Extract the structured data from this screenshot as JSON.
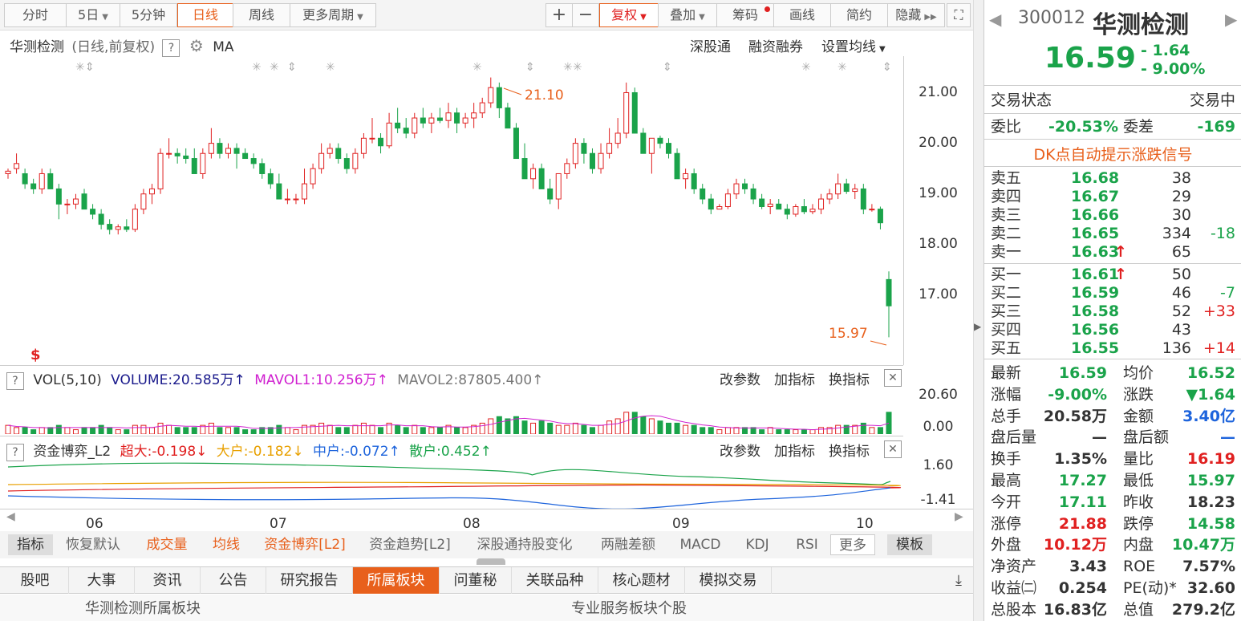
{
  "toolbar": {
    "buttons": [
      "分时",
      "5日",
      "5分钟",
      "日线",
      "周线",
      "更多周期"
    ],
    "plus": "+",
    "minus": "−",
    "fuquan": "复权",
    "diejia": "叠加",
    "chouma": "筹码",
    "huaxian": "画线",
    "jianyue": "简约",
    "yincang": "隐藏"
  },
  "chart_header": {
    "name": "华测检测",
    "mode": "(日线,前复权)",
    "q": "?",
    "ma": "MA"
  },
  "chart_links": {
    "sgt": "深股通",
    "rzrq": "融资融券",
    "ma_setting": "设置均线"
  },
  "price_axis": [
    "21.00",
    "20.00",
    "19.00",
    "18.00",
    "17.00"
  ],
  "annotations": {
    "high": "21.10",
    "low": "15.97",
    "s_mark": "$"
  },
  "vol_panel": {
    "label": "VOL(5,10)",
    "volume": "VOLUME:20.585万",
    "mavol1": "MAVOL1:10.256万",
    "mavol2": "MAVOL2:87805.400",
    "axis_top": "20.60",
    "axis_bottom": "0.00"
  },
  "fund_panel": {
    "label": "资金博弈_L2",
    "super": "超大:-0.198",
    "large": "大户:-0.182",
    "mid": "中户:-0.072",
    "retail": "散户:0.452",
    "axis_top": "1.60",
    "axis_bottom": "-1.41"
  },
  "panel_links": {
    "gai": "改参数",
    "jia": "加指标",
    "huan": "换指标"
  },
  "months": [
    "06",
    "07",
    "08",
    "09",
    "10"
  ],
  "indicator_tabs": [
    "指标",
    "恢复默认",
    "成交量",
    "均线",
    "资金博弈[L2]",
    "资金趋势[L2]",
    "深股通持股变化",
    "两融差额",
    "MACD",
    "KDJ",
    "RSI",
    "更多",
    "模板"
  ],
  "bottom_tabs": [
    "股吧",
    "大事",
    "资讯",
    "公告",
    "研究报告",
    "所属板块",
    "问董秘",
    "关联品种",
    "核心题材",
    "模拟交易"
  ],
  "sector_bar": {
    "left": "华测检测所属板块",
    "right": "专业服务板块个股"
  },
  "stock": {
    "code": "300012",
    "name": "华测检测",
    "price": "16.59",
    "change": "- 1.64",
    "pct": "- 9.00%"
  },
  "status": {
    "label": "交易状态",
    "value": "交易中"
  },
  "weibi": {
    "label": "委比",
    "value": "-20.53%",
    "wc_label": "委差",
    "wc_value": "-169"
  },
  "dk_signal": "DK点自动提示涨跌信号",
  "asks": [
    {
      "label": "卖五",
      "price": "16.68",
      "vol": "38",
      "chg": ""
    },
    {
      "label": "卖四",
      "price": "16.67",
      "vol": "29",
      "chg": ""
    },
    {
      "label": "卖三",
      "price": "16.66",
      "vol": "30",
      "chg": ""
    },
    {
      "label": "卖二",
      "price": "16.65",
      "vol": "334",
      "chg": "-18"
    },
    {
      "label": "卖一",
      "price": "16.63",
      "vol": "65",
      "chg": "",
      "arrow": "↑"
    }
  ],
  "bids": [
    {
      "label": "买一",
      "price": "16.61",
      "vol": "50",
      "chg": "",
      "arrow": "↑"
    },
    {
      "label": "买二",
      "price": "16.59",
      "vol": "46",
      "chg": "-7"
    },
    {
      "label": "买三",
      "price": "16.58",
      "vol": "52",
      "chg": "+33"
    },
    {
      "label": "买四",
      "price": "16.56",
      "vol": "43",
      "chg": ""
    },
    {
      "label": "买五",
      "price": "16.55",
      "vol": "136",
      "chg": "+14"
    }
  ],
  "stats": [
    {
      "l1": "最新",
      "v1": "16.59",
      "c1": "green",
      "l2": "均价",
      "v2": "16.52",
      "c2": "green"
    },
    {
      "l1": "涨幅",
      "v1": "-9.00%",
      "c1": "green",
      "l2": "涨跌",
      "v2": "▼1.64",
      "c2": "green"
    },
    {
      "l1": "总手",
      "v1": "20.58万",
      "c1": "black",
      "l2": "金额",
      "v2": "3.40亿",
      "c2": "blue"
    },
    {
      "l1": "盘后量",
      "v1": "—",
      "c1": "black",
      "l2": "盘后额",
      "v2": "—",
      "c2": "blue"
    },
    {
      "l1": "换手",
      "v1": "1.35%",
      "c1": "black",
      "l2": "量比",
      "v2": "16.19",
      "c2": "red"
    },
    {
      "l1": "最高",
      "v1": "17.27",
      "c1": "green",
      "l2": "最低",
      "v2": "15.97",
      "c2": "green"
    },
    {
      "l1": "今开",
      "v1": "17.11",
      "c1": "green",
      "l2": "昨收",
      "v2": "18.23",
      "c2": "black"
    },
    {
      "l1": "涨停",
      "v1": "21.88",
      "c1": "red",
      "l2": "跌停",
      "v2": "14.58",
      "c2": "green"
    },
    {
      "l1": "外盘",
      "v1": "10.12万",
      "c1": "red",
      "l2": "内盘",
      "v2": "10.47万",
      "c2": "green"
    },
    {
      "l1": "净资产",
      "v1": "3.43",
      "c1": "black",
      "l2": "ROE",
      "v2": "7.57%",
      "c2": "black"
    },
    {
      "l1": "收益㈡",
      "v1": "0.254",
      "c1": "black",
      "l2": "PE(动)*",
      "v2": "32.60",
      "c2": "black"
    },
    {
      "l1": "总股本",
      "v1": "16.83亿",
      "c1": "black",
      "l2": "总值",
      "v2": "279.2亿",
      "c2": "black"
    }
  ],
  "colors": {
    "up": "#e02020",
    "down": "#1aa34a",
    "accent": "#e8601c",
    "blue": "#1e64dc"
  },
  "chart_data": {
    "type": "candlestick",
    "price_ylim": [
      15.5,
      21.6
    ],
    "candles": [
      [
        19.2,
        19.3,
        19.1,
        19.25
      ],
      [
        19.3,
        19.6,
        19.2,
        19.4
      ],
      [
        19.2,
        19.3,
        18.9,
        19.0
      ],
      [
        19.0,
        19.1,
        18.8,
        18.9
      ],
      [
        18.9,
        19.3,
        18.8,
        19.2
      ],
      [
        19.2,
        19.3,
        18.9,
        18.9
      ],
      [
        18.9,
        19.0,
        18.3,
        18.6
      ],
      [
        18.6,
        18.7,
        18.4,
        18.6
      ],
      [
        18.6,
        18.8,
        18.5,
        18.7
      ],
      [
        18.8,
        18.9,
        18.5,
        18.5
      ],
      [
        18.5,
        18.6,
        18.3,
        18.4
      ],
      [
        18.4,
        18.5,
        18.1,
        18.2
      ],
      [
        18.2,
        18.3,
        18.0,
        18.1
      ],
      [
        18.1,
        18.2,
        18.0,
        18.15
      ],
      [
        18.15,
        18.3,
        18.05,
        18.1
      ],
      [
        18.1,
        18.6,
        18.05,
        18.5
      ],
      [
        18.5,
        18.9,
        18.4,
        18.8
      ],
      [
        18.8,
        19.0,
        18.6,
        18.9
      ],
      [
        18.9,
        19.7,
        18.8,
        19.6
      ],
      [
        19.6,
        19.9,
        19.5,
        19.6
      ],
      [
        19.6,
        19.7,
        19.4,
        19.55
      ],
      [
        19.55,
        19.7,
        19.4,
        19.5
      ],
      [
        19.5,
        19.7,
        19.2,
        19.2
      ],
      [
        19.2,
        19.7,
        19.1,
        19.6
      ],
      [
        19.6,
        20.1,
        19.5,
        19.8
      ],
      [
        19.8,
        19.9,
        19.5,
        19.6
      ],
      [
        19.6,
        19.8,
        19.5,
        19.7
      ],
      [
        19.7,
        19.8,
        19.3,
        19.6
      ],
      [
        19.6,
        19.7,
        19.5,
        19.5
      ],
      [
        19.5,
        19.6,
        19.3,
        19.4
      ],
      [
        19.4,
        19.5,
        19.1,
        19.2
      ],
      [
        19.2,
        19.3,
        18.9,
        19.0
      ],
      [
        19.0,
        19.2,
        18.7,
        18.7
      ],
      [
        18.7,
        18.9,
        18.6,
        18.7
      ],
      [
        18.7,
        18.8,
        18.6,
        18.7
      ],
      [
        18.7,
        19.3,
        18.6,
        19.0
      ],
      [
        19.0,
        19.4,
        18.9,
        19.3
      ],
      [
        19.3,
        19.8,
        19.2,
        19.6
      ],
      [
        19.6,
        19.8,
        19.5,
        19.7
      ],
      [
        19.7,
        19.8,
        19.4,
        19.5
      ],
      [
        19.5,
        19.6,
        19.2,
        19.3
      ],
      [
        19.3,
        19.7,
        19.2,
        19.6
      ],
      [
        19.6,
        20.0,
        19.5,
        19.9
      ],
      [
        19.9,
        20.3,
        19.8,
        19.9
      ],
      [
        19.9,
        20.0,
        19.6,
        19.75
      ],
      [
        19.75,
        20.4,
        19.7,
        20.2
      ],
      [
        20.2,
        20.5,
        20.0,
        20.1
      ],
      [
        20.1,
        20.3,
        19.9,
        20.0
      ],
      [
        20.0,
        20.4,
        19.9,
        20.3
      ],
      [
        20.3,
        20.5,
        20.1,
        20.2
      ],
      [
        20.2,
        20.4,
        20.0,
        20.3
      ],
      [
        20.3,
        20.5,
        20.2,
        20.25
      ],
      [
        20.25,
        20.6,
        20.1,
        20.4
      ],
      [
        20.4,
        20.5,
        20.0,
        20.2
      ],
      [
        20.2,
        20.4,
        20.1,
        20.3
      ],
      [
        20.3,
        20.6,
        20.1,
        20.4
      ],
      [
        20.4,
        20.7,
        20.3,
        20.6
      ],
      [
        20.6,
        21.1,
        20.5,
        20.9
      ],
      [
        20.9,
        21.0,
        20.3,
        20.5
      ],
      [
        20.5,
        20.6,
        20.1,
        20.1
      ],
      [
        20.1,
        20.2,
        19.5,
        19.5
      ],
      [
        19.5,
        19.8,
        19.1,
        19.1
      ],
      [
        19.1,
        19.4,
        18.9,
        19.3
      ],
      [
        19.3,
        19.4,
        18.9,
        18.9
      ],
      [
        18.9,
        19.1,
        18.6,
        18.7
      ],
      [
        18.7,
        19.2,
        18.5,
        19.2
      ],
      [
        19.2,
        19.5,
        19.1,
        19.4
      ],
      [
        19.4,
        19.9,
        19.3,
        19.8
      ],
      [
        19.8,
        19.9,
        19.4,
        19.6
      ],
      [
        19.6,
        19.7,
        19.2,
        19.3
      ],
      [
        19.3,
        19.8,
        19.2,
        19.6
      ],
      [
        19.6,
        20.1,
        19.5,
        19.8
      ],
      [
        19.8,
        20.3,
        19.7,
        20.0
      ],
      [
        20.0,
        21.0,
        19.9,
        20.8
      ],
      [
        20.8,
        20.9,
        20.0,
        20.0
      ],
      [
        20.0,
        20.1,
        19.6,
        19.6
      ],
      [
        19.6,
        19.9,
        19.2,
        19.9
      ],
      [
        19.9,
        19.95,
        19.7,
        19.8
      ],
      [
        19.8,
        19.9,
        19.5,
        19.6
      ],
      [
        19.6,
        19.7,
        19.1,
        19.1
      ],
      [
        19.1,
        19.3,
        18.9,
        19.2
      ],
      [
        19.2,
        19.3,
        18.8,
        18.9
      ],
      [
        18.9,
        19.0,
        18.6,
        18.7
      ],
      [
        18.7,
        18.8,
        18.4,
        18.5
      ],
      [
        18.5,
        18.6,
        18.5,
        18.55
      ],
      [
        18.55,
        18.9,
        18.5,
        18.8
      ],
      [
        18.8,
        19.1,
        18.7,
        19.0
      ],
      [
        19.0,
        19.1,
        18.8,
        18.9
      ],
      [
        18.9,
        19.0,
        18.6,
        18.7
      ],
      [
        18.7,
        18.8,
        18.5,
        18.55
      ],
      [
        18.55,
        18.7,
        18.4,
        18.6
      ],
      [
        18.6,
        18.7,
        18.5,
        18.5
      ],
      [
        18.5,
        18.6,
        18.3,
        18.4
      ],
      [
        18.4,
        18.6,
        18.35,
        18.55
      ],
      [
        18.55,
        18.7,
        18.4,
        18.45
      ],
      [
        18.45,
        18.6,
        18.4,
        18.5
      ],
      [
        18.5,
        18.8,
        18.4,
        18.7
      ],
      [
        18.7,
        18.9,
        18.6,
        18.8
      ],
      [
        18.8,
        19.2,
        18.7,
        19.0
      ],
      [
        19.0,
        19.1,
        18.8,
        18.85
      ],
      [
        18.85,
        19.0,
        18.7,
        18.9
      ],
      [
        18.9,
        19.0,
        18.4,
        18.5
      ],
      [
        18.5,
        18.6,
        18.45,
        18.5
      ],
      [
        18.5,
        18.55,
        18.1,
        18.23
      ],
      [
        17.11,
        17.27,
        15.97,
        16.59
      ]
    ],
    "volume": [
      4,
      3,
      3,
      2,
      3,
      3,
      4,
      3,
      2,
      3,
      3,
      4,
      3,
      2,
      2,
      4,
      4,
      3,
      5,
      4,
      3,
      3,
      3,
      4,
      5,
      3,
      3,
      3,
      2,
      2,
      3,
      3,
      4,
      3,
      2,
      4,
      4,
      5,
      4,
      3,
      3,
      4,
      5,
      4,
      3,
      5,
      4,
      3,
      4,
      3,
      3,
      3,
      4,
      3,
      3,
      4,
      5,
      7,
      8,
      7,
      8,
      6,
      5,
      6,
      5,
      4,
      4,
      5,
      4,
      3,
      4,
      6,
      7,
      10,
      10,
      8,
      7,
      6,
      5,
      5,
      4,
      4,
      3,
      3,
      2,
      3,
      3,
      3,
      3,
      2,
      3,
      2,
      2,
      2,
      2,
      2,
      3,
      3,
      4,
      4,
      4,
      5,
      3,
      3,
      10
    ],
    "vol_ylim": [
      0,
      20.6
    ],
    "fund_ylim": [
      -1.41,
      1.6
    ]
  }
}
